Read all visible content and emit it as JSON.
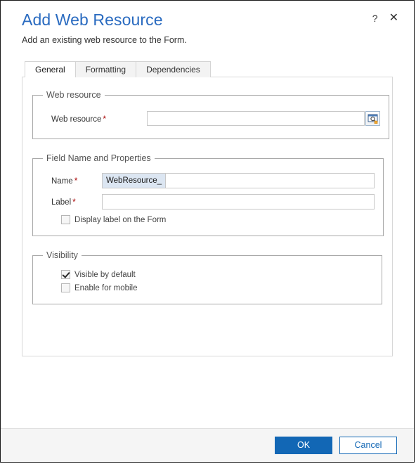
{
  "dialog": {
    "title": "Add Web Resource",
    "subtitle": "Add an existing web resource to the Form.",
    "help_icon": "?",
    "close_icon": "✕",
    "accent_color": "#2a6bc0",
    "primary_button_color": "#1267b5",
    "required_marker": "*"
  },
  "tabs": [
    {
      "label": "General",
      "active": true
    },
    {
      "label": "Formatting",
      "active": false
    },
    {
      "label": "Dependencies",
      "active": false
    }
  ],
  "sections": {
    "web_resource": {
      "legend": "Web resource",
      "field_label": "Web resource",
      "field_value": "",
      "field_placeholder": "",
      "lookup_icon": "lookup-browse-icon"
    },
    "field_name_properties": {
      "legend": "Field Name and Properties",
      "name_label": "Name",
      "name_prefix": "WebResource_",
      "name_value": "",
      "label_label": "Label",
      "label_value": "",
      "display_label_checkbox": {
        "label": "Display label on the Form",
        "checked": false
      }
    },
    "visibility": {
      "legend": "Visibility",
      "visible_by_default": {
        "label": "Visible by default",
        "checked": true
      },
      "enable_for_mobile": {
        "label": "Enable for mobile",
        "checked": false
      }
    }
  },
  "footer": {
    "ok_label": "OK",
    "cancel_label": "Cancel"
  }
}
